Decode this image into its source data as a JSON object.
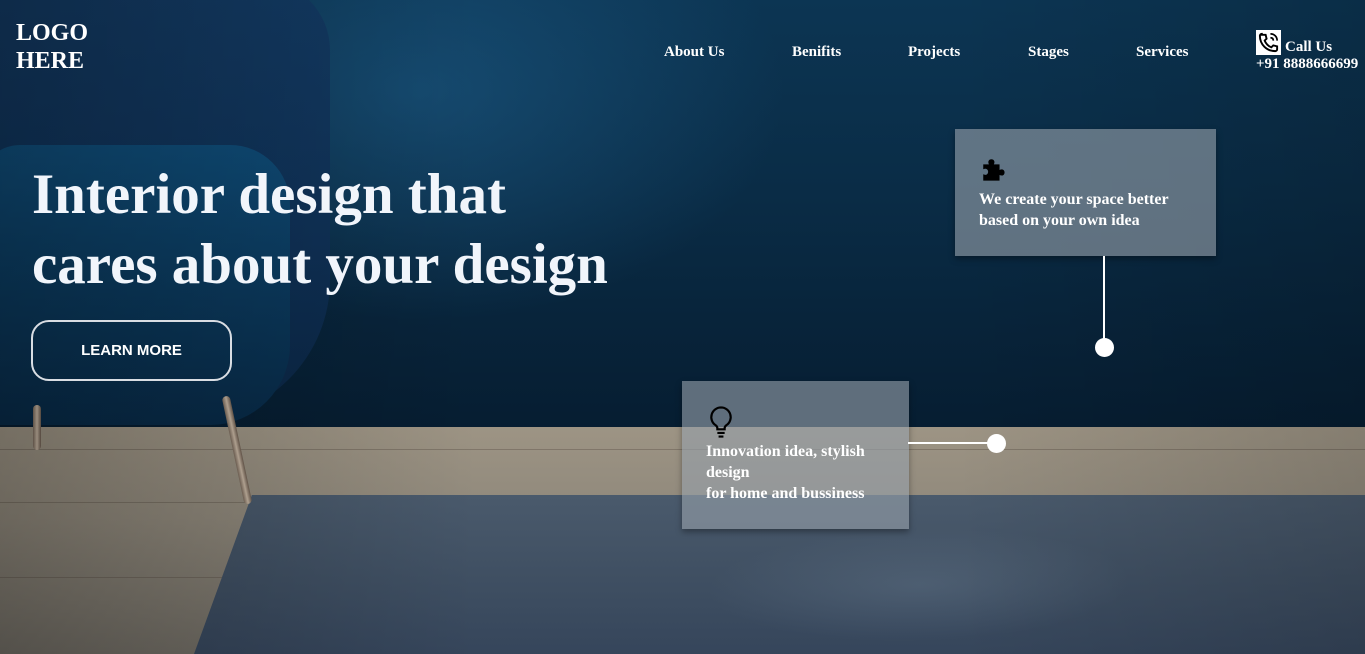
{
  "header": {
    "logo_line1": "LOGO",
    "logo_line2": "HERE",
    "nav": [
      "About Us",
      "Benifits",
      "Projects",
      "Stages",
      "Services"
    ],
    "call_label": "Call Us",
    "call_number": "+91 8888666699"
  },
  "hero": {
    "title_line1": "Interior design that",
    "title_line2": "cares about your design",
    "cta_label": "LEARN MORE"
  },
  "cards": [
    {
      "icon": "puzzle-icon",
      "line1": "We create your space better",
      "line2": "based on your own idea"
    },
    {
      "icon": "lightbulb-icon",
      "line1": "Innovation idea, stylish",
      "line2": "design",
      "line3": "for home and bussiness"
    }
  ]
}
